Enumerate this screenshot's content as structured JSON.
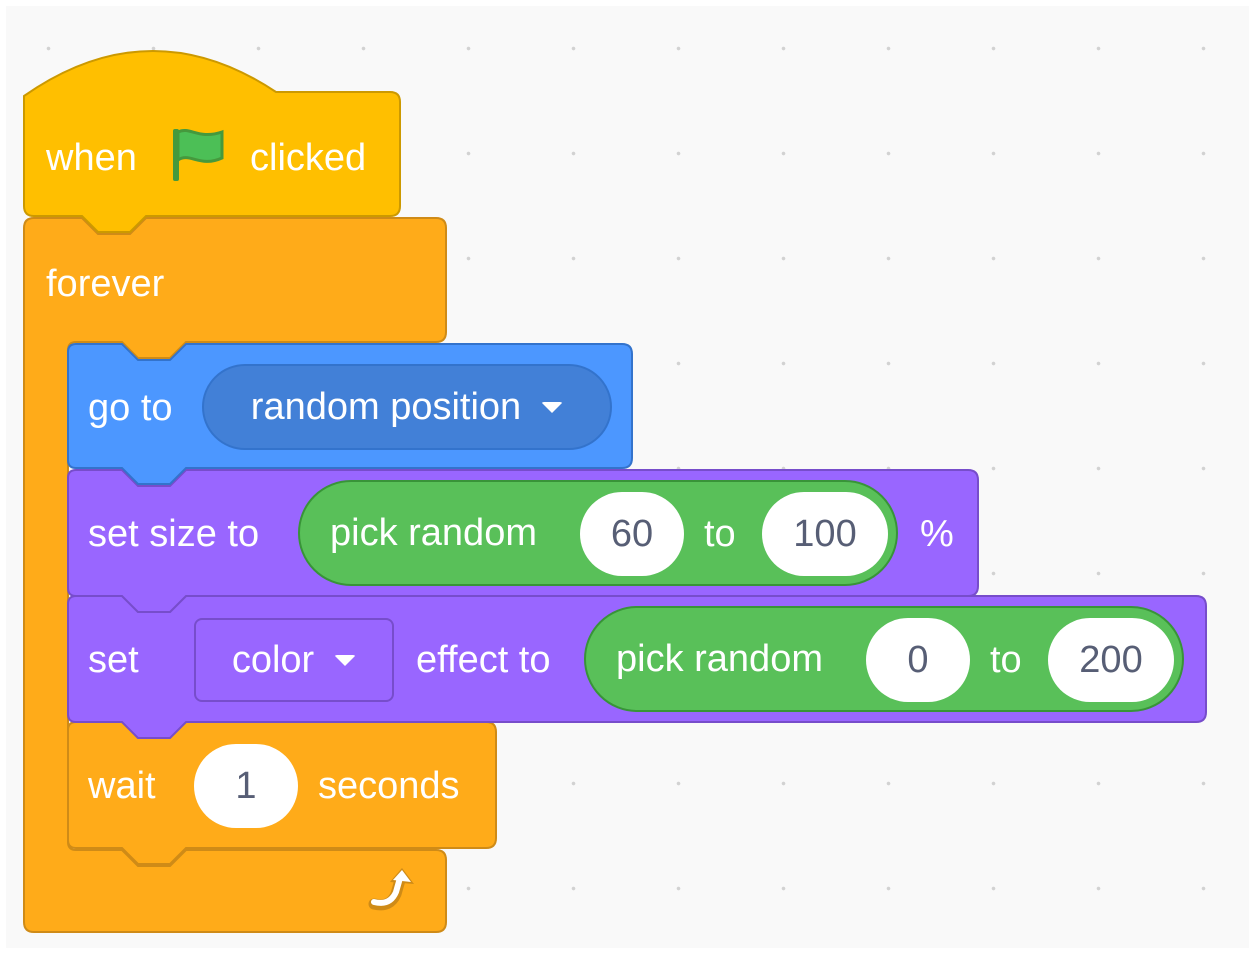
{
  "colors": {
    "events": "#ffbf00",
    "control": "#ffab19",
    "motion": "#4c97ff",
    "looks": "#9966ff",
    "operators": "#59c059",
    "workspace": "#f9f9f9"
  },
  "script": {
    "hat_block": {
      "label_when": "when",
      "icon": "green-flag-icon",
      "label_clicked": "clicked"
    },
    "forever_block": {
      "label": "forever",
      "icon": "loop-arrow-icon"
    },
    "goto_block": {
      "label": "go to",
      "menu_value": "random position"
    },
    "set_size_block": {
      "label": "set size to",
      "reporter": {
        "label": "pick random",
        "from": "60",
        "to_label": "to",
        "to": "100"
      },
      "suffix": "%"
    },
    "set_effect_block": {
      "label": "set",
      "menu_value": "color",
      "label_effect": "effect to",
      "reporter": {
        "label": "pick random",
        "from": "0",
        "to_label": "to",
        "to": "200"
      }
    },
    "wait_block": {
      "label": "wait",
      "value": "1",
      "label_seconds": "seconds"
    }
  }
}
